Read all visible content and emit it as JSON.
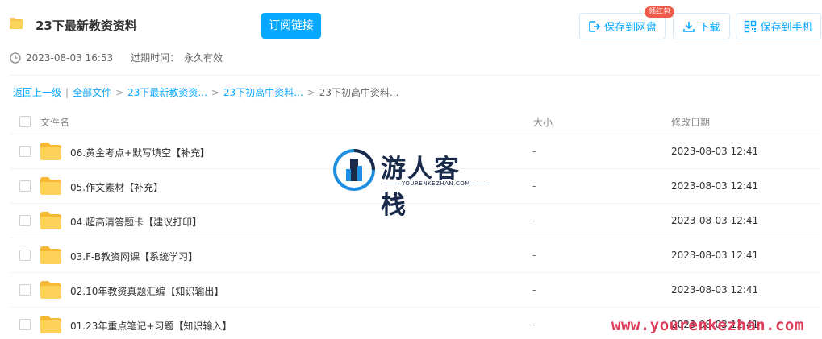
{
  "header": {
    "title": "23下最新教资资料",
    "subscribe_label": "订阅链接",
    "save_pan_label": "保存到网盘",
    "badge_label": "领红包",
    "download_label": "下载",
    "save_phone_label": "保存到手机",
    "accent_color": "#06a7ff"
  },
  "meta": {
    "share_time": "2023-08-03 16:53",
    "expire_label": "过期时间：",
    "expire_value": "永久有效"
  },
  "breadcrumb": {
    "back": "返回上一级",
    "all_files": "全部文件",
    "level1": "23下最新教资资...",
    "level2": "23下初高中资料...",
    "current": "23下初高中资料..."
  },
  "table": {
    "headers": {
      "name": "文件名",
      "size": "大小",
      "date": "修改日期"
    },
    "rows": [
      {
        "name": "06.黄金考点+默写填空【补充】",
        "size": "-",
        "date": "2023-08-03 12:41"
      },
      {
        "name": "05.作文素材【补充】",
        "size": "-",
        "date": "2023-08-03 12:41"
      },
      {
        "name": "04.超高清答题卡【建议打印】",
        "size": "-",
        "date": "2023-08-03 12:41"
      },
      {
        "name": "03.F-B教资网课【系统学习】",
        "size": "-",
        "date": "2023-08-03 12:41"
      },
      {
        "name": "02.10年教资真题汇编【知识输出】",
        "size": "-",
        "date": "2023-08-03 12:41"
      },
      {
        "name": "01.23年重点笔记+习题【知识输入】",
        "size": "-",
        "date": "2023-08-03 12:41"
      }
    ]
  },
  "watermark": {
    "title": "游人客栈",
    "url_small": "YOURENKEZHAN.COM",
    "url_bottom": "www.yourenkezhan.com"
  }
}
